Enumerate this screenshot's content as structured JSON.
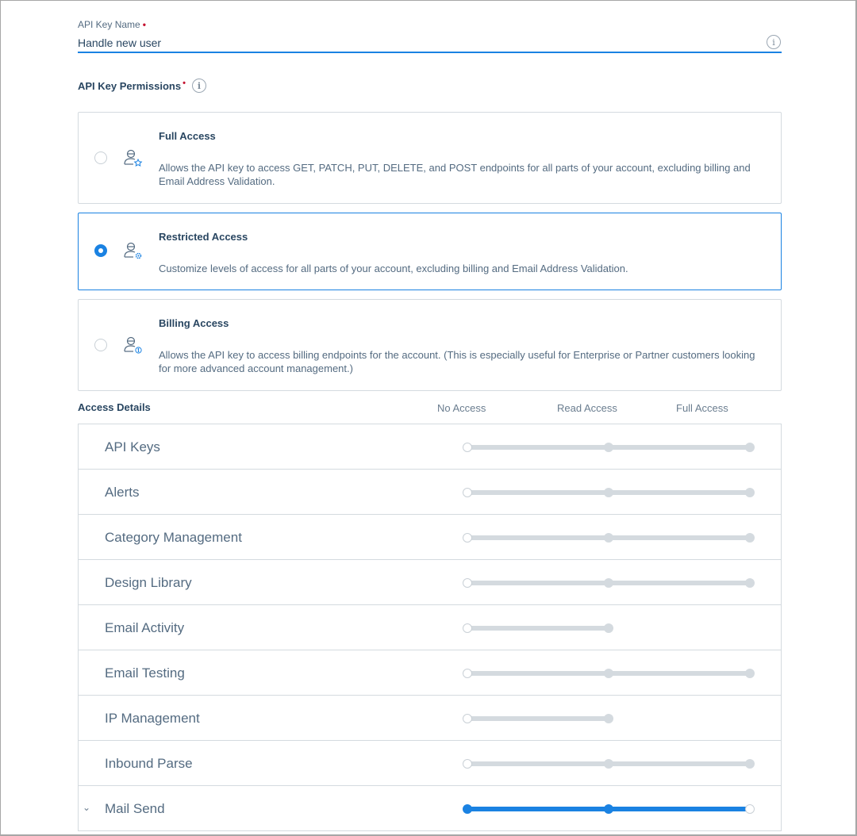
{
  "name_field": {
    "label": "API Key Name",
    "required_mark": "•",
    "value": "Handle new user"
  },
  "permissions": {
    "title": "API Key Permissions",
    "required_mark": "•",
    "options": [
      {
        "title": "Full Access",
        "description": "Allows the API key to access GET, PATCH, PUT, DELETE, and POST endpoints for all parts of your account, excluding billing and Email Address Validation.",
        "selected": false,
        "icon": "user-star-icon"
      },
      {
        "title": "Restricted Access",
        "description": "Customize levels of access for all parts of your account, excluding billing and Email Address Validation.",
        "selected": true,
        "icon": "user-gear-icon"
      },
      {
        "title": "Billing Access",
        "description": "Allows the API key to access billing endpoints for the account. (This is especially useful for Enterprise or Partner customers looking for more advanced account management.)",
        "selected": false,
        "icon": "user-dollar-icon"
      }
    ]
  },
  "access_details": {
    "title": "Access Details",
    "columns": [
      "No Access",
      "Read Access",
      "Full Access"
    ],
    "rows": [
      {
        "label": "API Keys",
        "levels": 3,
        "value": "No Access"
      },
      {
        "label": "Alerts",
        "levels": 3,
        "value": "No Access"
      },
      {
        "label": "Category Management",
        "levels": 3,
        "value": "No Access"
      },
      {
        "label": "Design Library",
        "levels": 3,
        "value": "No Access"
      },
      {
        "label": "Email Activity",
        "levels": 2,
        "value": "No Access"
      },
      {
        "label": "Email Testing",
        "levels": 3,
        "value": "No Access"
      },
      {
        "label": "IP Management",
        "levels": 2,
        "value": "No Access"
      },
      {
        "label": "Inbound Parse",
        "levels": 3,
        "value": "No Access"
      },
      {
        "label": "Mail Send",
        "levels": 3,
        "value": "Full Access",
        "expandable": true
      }
    ]
  },
  "colors": {
    "accent": "#1a82e2",
    "border": "#d4dadf",
    "text": "#294661",
    "required": "#c41230"
  }
}
